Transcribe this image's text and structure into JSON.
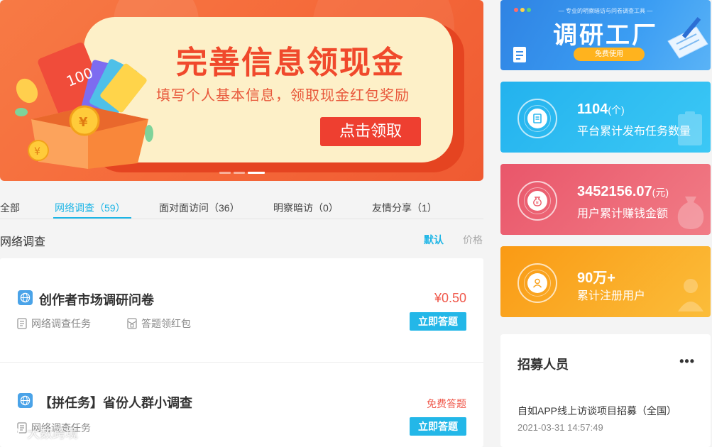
{
  "banner": {
    "headline_part1": "完善信息",
    "headline_part2": "领现金",
    "subtitle": "填写个人基本信息，领取现金红包奖励",
    "cta_label": "点击领取",
    "gift_amount": "100",
    "gift_coin": "¥"
  },
  "tabs": [
    {
      "label": "全部"
    },
    {
      "label": "网络调查（59）",
      "active": true
    },
    {
      "label": "面对面访问（36）"
    },
    {
      "label": "明察暗访（0）"
    },
    {
      "label": "友情分享（1）"
    }
  ],
  "section": {
    "title": "网络调查",
    "sort_default": "默认",
    "sort_price": "价格"
  },
  "tasks": [
    {
      "title": "创作者市场调研问卷",
      "type": "网络调查任务",
      "reward_type": "答题领红包",
      "price": "¥0.50",
      "action": "立即答题"
    },
    {
      "title": "【拼任务】省份人群小调查",
      "type": "网络调查任务",
      "price": "免费答题",
      "action": "立即答题"
    }
  ],
  "promo": {
    "tagline": "— 专业的明察暗访与问卷调查工具 —",
    "title": "调研工厂",
    "button": "免费使用"
  },
  "stats": [
    {
      "value": "1104",
      "unit": "(个)",
      "label": "平台累计发布任务数量",
      "color": "#2db8f0",
      "icon": "clipboard-icon"
    },
    {
      "value": "3452156.07",
      "unit": "(元)",
      "label": "用户累计赚钱金额",
      "color": "#ec5f6d",
      "icon": "money-bag-icon"
    },
    {
      "value": "90万+",
      "unit": "",
      "label": "累计注册用户",
      "color": "#f9a21c",
      "icon": "user-icon"
    }
  ],
  "recruit": {
    "title": "招募人员",
    "more": "•••",
    "item_title": "自如APP线上访谈项目招募（全国）",
    "item_time": "2021-03-31 14:57:49"
  },
  "watermark": {
    "text": "大数跨境"
  },
  "colors": {
    "accent": "#1cb5e6",
    "price": "#f0584b",
    "banner_red": "#f0492c"
  }
}
